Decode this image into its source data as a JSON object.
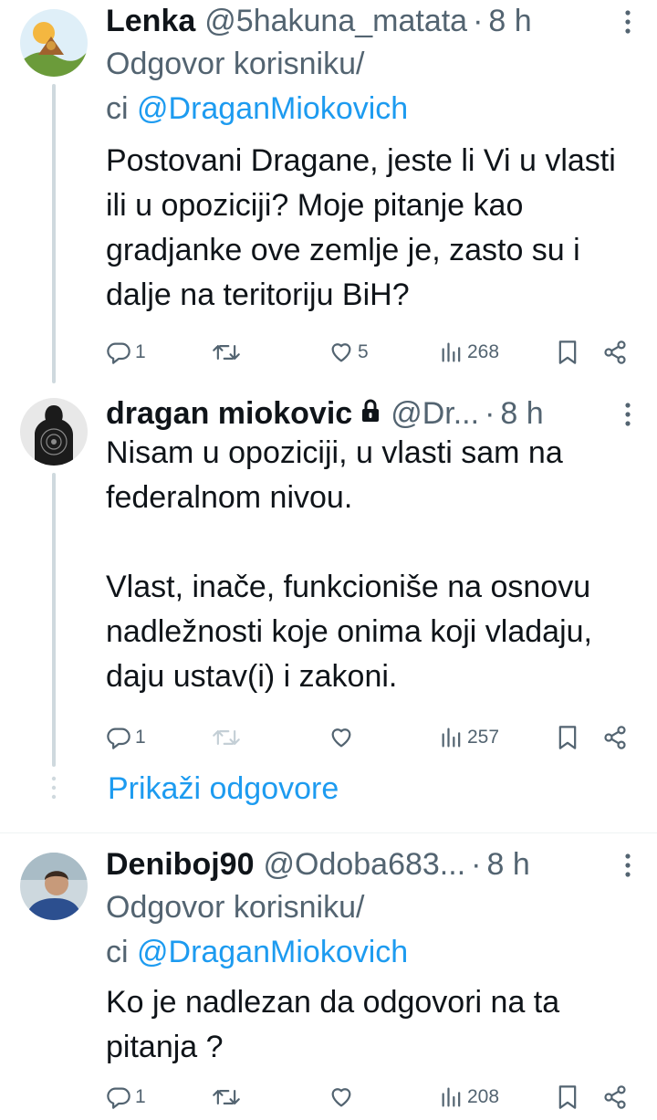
{
  "tweets": [
    {
      "name": "Lenka",
      "handle": "@5hakuna_matata",
      "dot": "·",
      "time": "8 h",
      "replying_prefix": "Odgovor korisniku/",
      "replying_prefix2": "ci ",
      "replying_mention": "@DraganMiokovich",
      "body": "Postovani Dragane, jeste li Vi u vlasti ili u opoziciji? Moje pitanje kao gradjanke ove zemlje je, zasto su i dalje na teritoriju BiH?",
      "replies": "1",
      "retweets": "",
      "likes": "5",
      "views": "268"
    },
    {
      "name": "dragan miokovic",
      "handle": "@Dr...",
      "dot": "·",
      "time": "8 h",
      "body_p1": "Nisam u opoziciji, u vlasti sam na federalnom nivou.",
      "body_p2": "Vlast, inače, funkcioniše na osnovu nadležnosti koje onima koji vladaju, daju ustav(i) i zakoni.",
      "replies": "1",
      "retweets": "",
      "likes": "",
      "views": "257"
    },
    {
      "name": "Deniboj90",
      "handle": "@Odoba683...",
      "dot": "·",
      "time": "8 h",
      "replying_prefix": "Odgovor korisniku/",
      "replying_prefix2": "ci ",
      "replying_mention": "@DraganMiokovich",
      "body": "Ko je nadlezan da odgovori na ta pitanja ?",
      "replies": "1",
      "retweets": "",
      "likes": "",
      "views": "208"
    }
  ],
  "show_replies_label": "Prikaži odgovore",
  "colors": {
    "accent": "#1d9bf0",
    "secondary_text": "#536471",
    "thread_line": "#cfd9de"
  },
  "icons": [
    "reply-icon",
    "retweet-icon",
    "like-icon",
    "views-icon",
    "bookmark-icon",
    "share-icon",
    "lock-icon",
    "more-icon"
  ]
}
